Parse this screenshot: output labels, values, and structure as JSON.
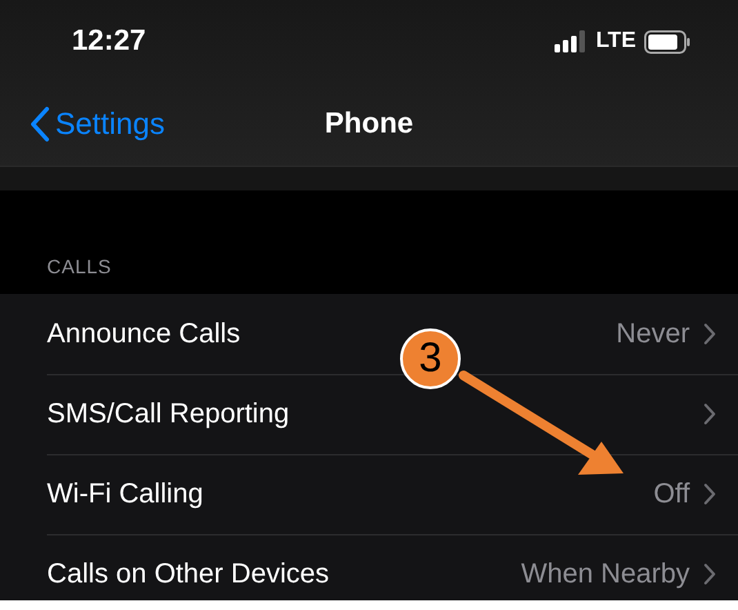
{
  "status_bar": {
    "time": "12:27",
    "network": "LTE"
  },
  "nav_bar": {
    "back_label": "Settings",
    "title": "Phone"
  },
  "section": {
    "header": "CALLS",
    "rows": [
      {
        "label": "Announce Calls",
        "value": "Never"
      },
      {
        "label": "SMS/Call Reporting"
      },
      {
        "label": "Wi-Fi Calling",
        "value": "Off"
      },
      {
        "label": "Calls on Other Devices",
        "value": "When Nearby"
      }
    ]
  },
  "annotation": {
    "label": "3"
  }
}
